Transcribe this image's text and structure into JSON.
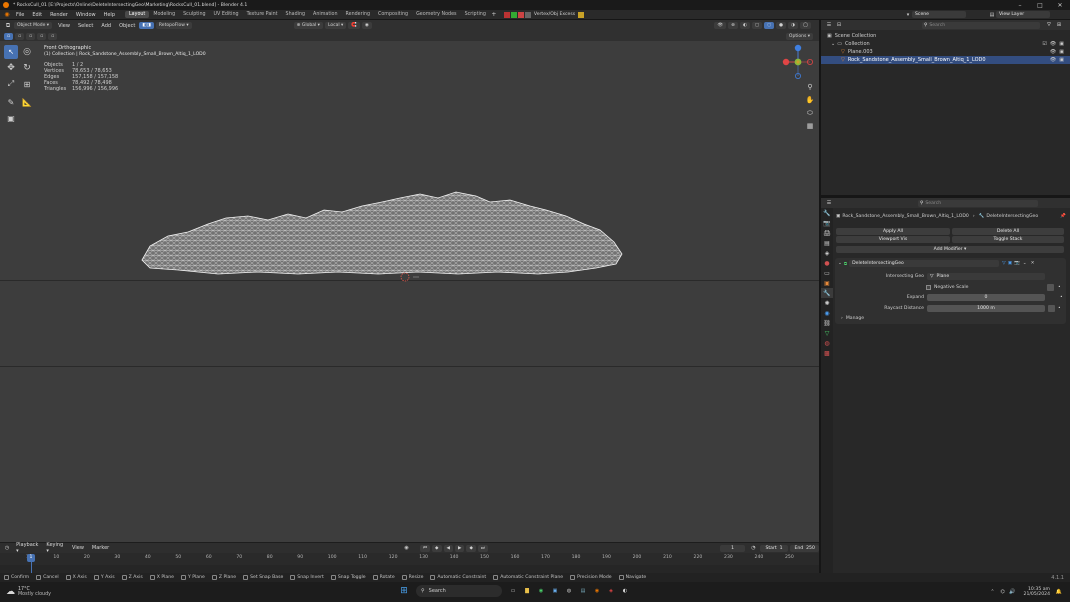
{
  "window": {
    "title": "* RocksCull_01 [E:\\Projects\\Online\\DeleteIntersectingGeo\\Marketing\\RocksCull_01.blend] - Blender 4.1",
    "controls": [
      "–",
      "□",
      "✕"
    ]
  },
  "menus": [
    "File",
    "Edit",
    "Render",
    "Window",
    "Help"
  ],
  "workspaces": [
    "Layout",
    "Modeling",
    "Sculpting",
    "UV Editing",
    "Texture Paint",
    "Shading",
    "Animation",
    "Rendering",
    "Compositing",
    "Geometry Nodes",
    "Scripting"
  ],
  "active_workspace": "Layout",
  "addon_header": {
    "label": "Vertex/Obj Excess"
  },
  "scene": {
    "scene_name": "Scene",
    "view_layer": "View Layer"
  },
  "viewport": {
    "mode": "Object Mode",
    "header_menus": [
      "View",
      "Select",
      "Add",
      "Object"
    ],
    "transform_orientation": "Global",
    "pivot": "Local",
    "addon_dropdown": "RetopoFlow",
    "options_label": "Options",
    "view_name": "Front Orthographic",
    "collection_line": "(1) Collection | Rock_Sandstone_Assembly_Small_Brown_Altiq_1_LOD0",
    "stats": [
      {
        "label": "Objects",
        "value": "1 / 2"
      },
      {
        "label": "Vertices",
        "value": "78,653 / 78,653"
      },
      {
        "label": "Edges",
        "value": "157,158 / 157,158"
      },
      {
        "label": "Faces",
        "value": "78,492 / 78,498"
      },
      {
        "label": "Triangles",
        "value": "156,996 / 156,996"
      }
    ]
  },
  "outliner": {
    "search_placeholder": "Search",
    "items": [
      {
        "label": "Scene Collection",
        "depth": 0,
        "selected": false
      },
      {
        "label": "Collection",
        "depth": 1,
        "selected": false
      },
      {
        "label": "Plane.003",
        "depth": 2,
        "selected": false
      },
      {
        "label": "Rock_Sandstone_Assembly_Small_Brown_Altiq_1_LOD0",
        "depth": 2,
        "selected": true
      }
    ]
  },
  "properties": {
    "search_placeholder": "Search",
    "breadcrumb_object": "Rock_Sandstone_Assembly_Small_Brown_Altiq_1_LOD0",
    "breadcrumb_modifier": "DeleteIntersectingGeo",
    "apply_all": "Apply All",
    "delete_all": "Delete All",
    "viewport_vis": "Viewport Vis",
    "toggle_stack": "Toggle Stack",
    "add_modifier": "Add Modifier",
    "modifier": {
      "name": "DeleteIntersectingGeo",
      "intersecting_geo_label": "Intersecting Geo",
      "intersecting_geo_value": "Plane",
      "negative_scale_label": "Negative Scale",
      "expand_label": "Expand",
      "expand_value": "0",
      "raycast_distance_label": "Raycast Distance",
      "raycast_distance_value": "1000 m",
      "manage_label": "Manage"
    }
  },
  "timeline": {
    "menus": [
      "Playback",
      "Keying",
      "View",
      "Marker"
    ],
    "current_frame": "1",
    "start_label": "Start",
    "start_value": "1",
    "end_label": "End",
    "end_value": "250",
    "ticks": [
      "1",
      "10",
      "20",
      "30",
      "40",
      "50",
      "60",
      "70",
      "80",
      "90",
      "100",
      "110",
      "120",
      "130",
      "140",
      "150",
      "160",
      "170",
      "180",
      "190",
      "200",
      "210",
      "220",
      "230",
      "240",
      "250"
    ]
  },
  "statusbar": {
    "hints": [
      "Confirm",
      "Cancel",
      "X Axis",
      "Y Axis",
      "Z Axis",
      "X Plane",
      "Y Plane",
      "Z Plane",
      "Set Snap Base",
      "Snap Invert",
      "Snap Toggle",
      "Rotate",
      "Resize",
      "Automatic Constraint",
      "Automatic Constraint Plane",
      "Precision Mode",
      "Navigate"
    ],
    "version": "4.1.1"
  },
  "taskbar": {
    "weather_temp": "17°C",
    "weather_desc": "Mostly cloudy",
    "search_label": "Search",
    "time": "10:35 am",
    "date": "21/05/2024"
  },
  "colors": {
    "accent": "#4772b3",
    "selection": "#334d80",
    "background": "#3d3d3d"
  }
}
